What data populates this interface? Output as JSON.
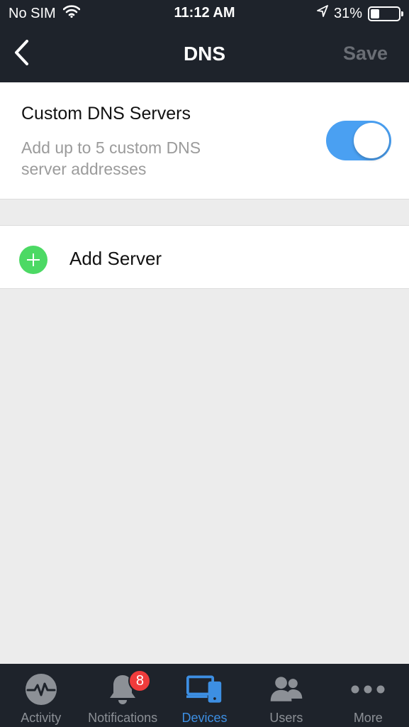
{
  "status_bar": {
    "carrier": "No SIM",
    "time": "11:12 AM",
    "battery": "31%",
    "battery_level": 0.31
  },
  "nav": {
    "title": "DNS",
    "save_label": "Save",
    "back_icon": "chevron-left-icon"
  },
  "dns": {
    "title": "Custom DNS Servers",
    "description": "Add up to 5 custom DNS server addresses",
    "enabled": true
  },
  "add_server": {
    "label": "Add Server",
    "icon": "plus-circle-icon"
  },
  "tabs": [
    {
      "label": "Activity",
      "icon": "activity-icon",
      "active": false
    },
    {
      "label": "Notifications",
      "icon": "bell-icon",
      "active": false,
      "badge": "8"
    },
    {
      "label": "Devices",
      "icon": "devices-icon",
      "active": true
    },
    {
      "label": "Users",
      "icon": "users-icon",
      "active": false
    },
    {
      "label": "More",
      "icon": "more-icon",
      "active": false
    }
  ],
  "colors": {
    "accent": "#4aa0f2",
    "bar_background": "#1e232b",
    "add_green": "#4cd964",
    "badge_red": "#f03c3c"
  }
}
